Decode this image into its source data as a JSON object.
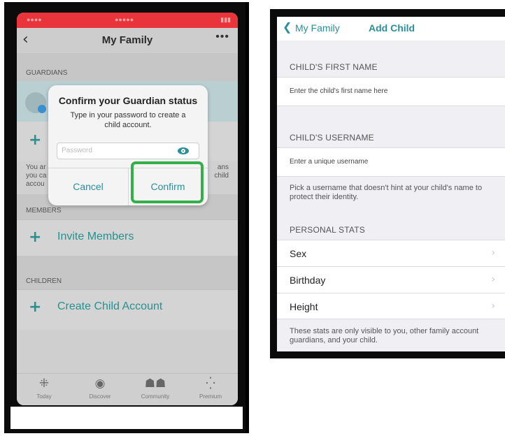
{
  "left_phone": {
    "nav": {
      "back_icon": "chevron-left",
      "title": "My Family",
      "more": "•••"
    },
    "sections": {
      "guardians": "GUARDIANS",
      "members": "MEMBERS",
      "children": "CHILDREN"
    },
    "guardians_text_left": [
      "You ar",
      "you ca",
      "accou"
    ],
    "guardians_text_right": [
      "ans",
      "child"
    ],
    "rows": {
      "invite_members": "Invite Members",
      "create_child": "Create Child Account"
    },
    "dialog": {
      "title": "Confirm your Guardian status",
      "message": "Type in your password to create a child account.",
      "password_placeholder": "Password",
      "cancel": "Cancel",
      "confirm": "Confirm"
    },
    "tabs": [
      {
        "icon": "today-dots-icon",
        "label": "Today"
      },
      {
        "icon": "compass-icon",
        "label": "Discover"
      },
      {
        "icon": "community-icon",
        "label": "Community"
      },
      {
        "icon": "premium-dots-icon",
        "label": "Premium"
      }
    ],
    "colors": {
      "status_bar": "#e8343a",
      "accent": "#2a8f9a",
      "highlight": "#34b04a"
    }
  },
  "right_phone": {
    "nav": {
      "back_label": "My Family",
      "title": "Add Child"
    },
    "first_name": {
      "header": "CHILD'S FIRST NAME",
      "placeholder": "Enter the child's first name here"
    },
    "username": {
      "header": "CHILD'S USERNAME",
      "placeholder": "Enter a unique username"
    },
    "username_note": "Pick a username that doesn't hint at your child's name to protect their identity.",
    "personal_stats": {
      "header": "PERSONAL STATS",
      "items": [
        "Sex",
        "Birthday",
        "Height"
      ]
    },
    "stats_note": "These stats are only visible to you, other family account guardians, and your child."
  }
}
